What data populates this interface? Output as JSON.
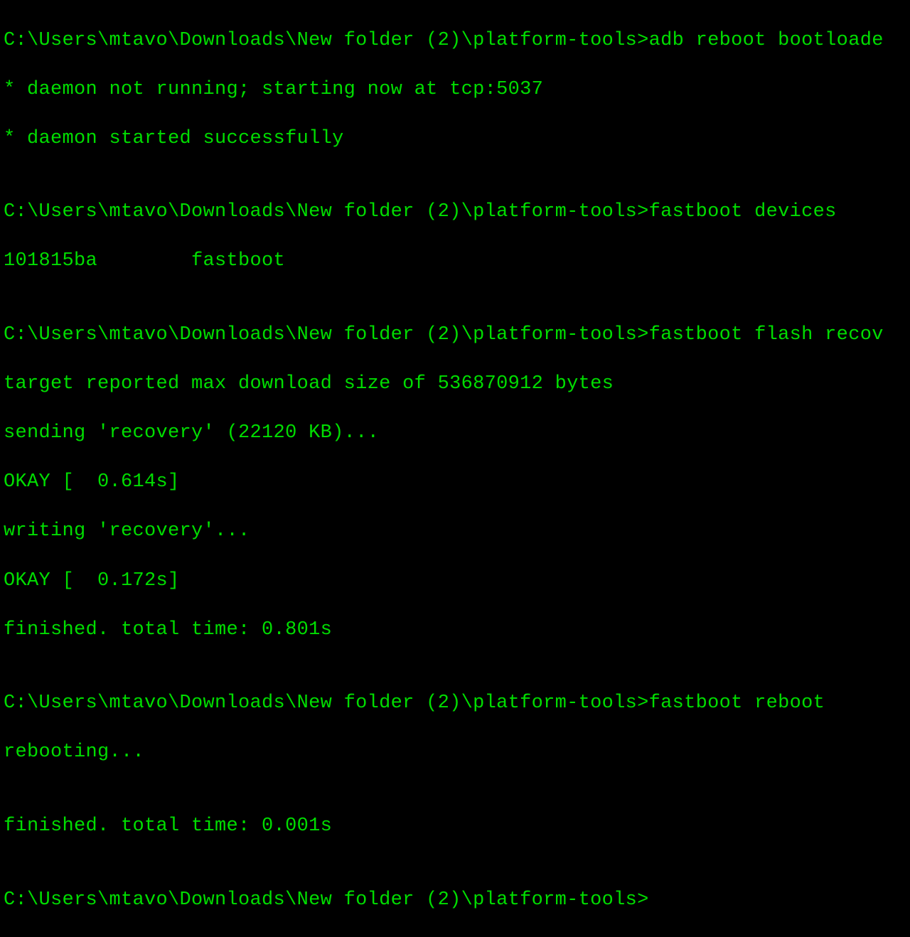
{
  "terminal": {
    "lines": [
      "C:\\Users\\mtavo\\Downloads\\New folder (2)\\platform-tools>adb reboot bootloade",
      "* daemon not running; starting now at tcp:5037",
      "* daemon started successfully",
      "",
      "C:\\Users\\mtavo\\Downloads\\New folder (2)\\platform-tools>fastboot devices",
      "101815ba        fastboot",
      "",
      "C:\\Users\\mtavo\\Downloads\\New folder (2)\\platform-tools>fastboot flash recov",
      "target reported max download size of 536870912 bytes",
      "sending 'recovery' (22120 KB)...",
      "OKAY [  0.614s]",
      "writing 'recovery'...",
      "OKAY [  0.172s]",
      "finished. total time: 0.801s",
      "",
      "C:\\Users\\mtavo\\Downloads\\New folder (2)\\platform-tools>fastboot reboot",
      "rebooting...",
      "",
      "finished. total time: 0.001s",
      "",
      "C:\\Users\\mtavo\\Downloads\\New folder (2)\\platform-tools>"
    ]
  }
}
